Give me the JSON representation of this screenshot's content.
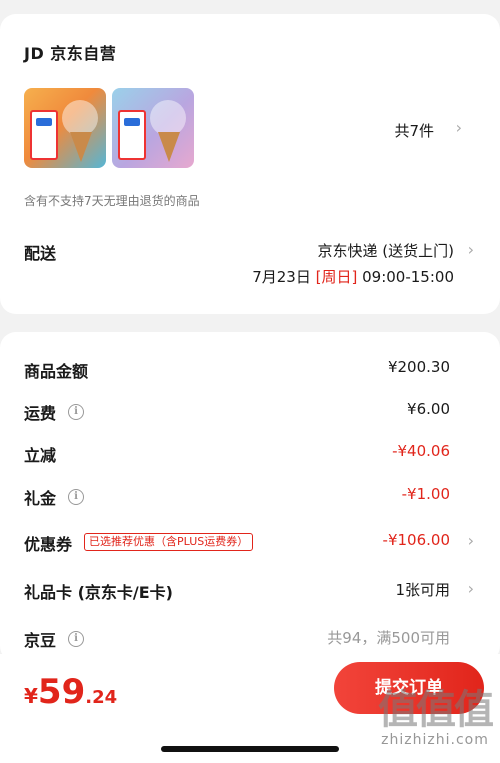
{
  "shop": {
    "name": "JD 京东自营",
    "item_count": "共7件",
    "return_note": "含有不支持7天无理由退货的商品"
  },
  "delivery": {
    "label": "配送",
    "method": "京东快递 (送货上门)",
    "date": "7月23日",
    "weekday": "[周日]",
    "time_range": "09:00-15:00"
  },
  "summary": {
    "items": [
      {
        "label": "商品金额",
        "value": "¥200.30"
      },
      {
        "label": "运费",
        "value": "¥6.00"
      },
      {
        "label": "立减",
        "value": "-¥40.06"
      },
      {
        "label": "礼金",
        "value": "-¥1.00"
      },
      {
        "label": "优惠券",
        "tag": "已选推荐优惠（含PLUS运费券）",
        "value": "-¥106.00"
      },
      {
        "label": "礼品卡 (京东卡/E卡)",
        "value": "1张可用"
      },
      {
        "label": "京豆",
        "value": "共94，满500可用"
      }
    ]
  },
  "footer": {
    "currency": "¥",
    "total_int": "59",
    "total_dec": ".24",
    "submit_label": "提交订单"
  },
  "watermark": {
    "glyphs": "值值值",
    "site": "zhizhizhi.com"
  },
  "colors": {
    "accent": "#e1251b",
    "background": "#f2f2f2"
  },
  "icons": [
    "info-icon",
    "chevron-right-icon"
  ]
}
